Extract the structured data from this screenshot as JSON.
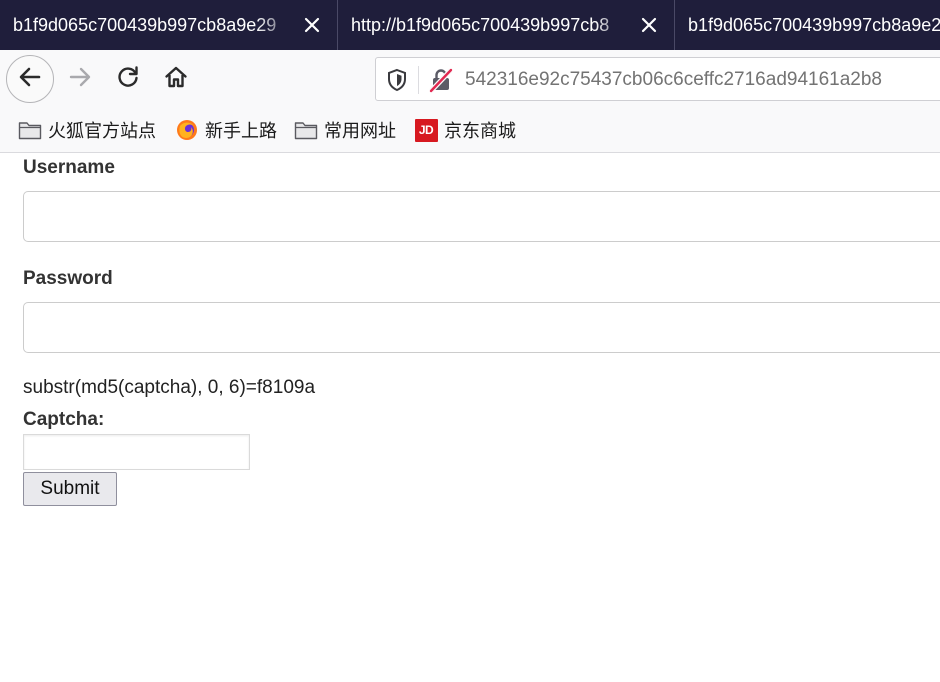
{
  "tabs": [
    {
      "title": "b1f9d065c700439b997cb8a9e29"
    },
    {
      "title": "http://b1f9d065c700439b997cb8"
    },
    {
      "title": "b1f9d065c700439b997cb8a9e2"
    }
  ],
  "navbar": {
    "url": "542316e92c75437cb06c6ceffc2716ad94161a2b8"
  },
  "bookmarks": [
    {
      "label": "火狐官方站点",
      "icon": "folder-icon"
    },
    {
      "label": "新手上路",
      "icon": "firefox-icon"
    },
    {
      "label": "常用网址",
      "icon": "folder-icon"
    },
    {
      "label": "京东商城",
      "icon": "jd-icon",
      "icon_text": "JD",
      "color": "#d71920"
    }
  ],
  "form": {
    "username_label": "Username",
    "password_label": "Password",
    "hint": "substr(md5(captcha), 0, 6)=f8109a",
    "captcha_label": "Captcha:",
    "submit_label": "Submit"
  },
  "colors": {
    "tabstrip": "#1f1e3b",
    "toolbar": "#f9f9fa"
  }
}
